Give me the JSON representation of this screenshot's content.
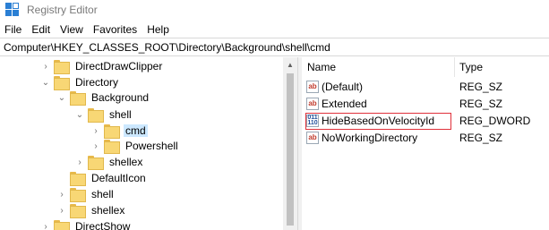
{
  "window": {
    "title": "Registry Editor",
    "accent_color": "#2a7fd4",
    "folder_color": "#f8d775"
  },
  "menu": [
    "File",
    "Edit",
    "View",
    "Favorites",
    "Help"
  ],
  "address": {
    "path": "Computer\\HKEY_CLASSES_ROOT\\Directory\\Background\\shell\\cmd"
  },
  "tree": [
    {
      "label": "DirectDrawClipper",
      "expander": "right"
    },
    {
      "label": "Directory",
      "expander": "down"
    },
    {
      "label": "Background",
      "expander": "down"
    },
    {
      "label": "shell",
      "expander": "down"
    },
    {
      "label": "cmd",
      "expander": "right",
      "selected": true
    },
    {
      "label": "Powershell",
      "expander": "right"
    },
    {
      "label": "shellex",
      "expander": "right"
    },
    {
      "label": "DefaultIcon",
      "expander": "none"
    },
    {
      "label": "shell",
      "expander": "right"
    },
    {
      "label": "shellex",
      "expander": "right"
    },
    {
      "label": "DirectShow",
      "expander": "right"
    }
  ],
  "list": {
    "columns": {
      "name": "Name",
      "type": "Type"
    },
    "rows": [
      {
        "icon": "string-value-icon",
        "icon_text": "ab",
        "name": "(Default)",
        "type": "REG_SZ"
      },
      {
        "icon": "string-value-icon",
        "icon_text": "ab",
        "name": "Extended",
        "type": "REG_SZ"
      },
      {
        "icon": "binary-value-icon",
        "icon_text": "011\n110",
        "name": "HideBasedOnVelocityId",
        "type": "REG_DWORD",
        "highlighted": true
      },
      {
        "icon": "string-value-icon",
        "icon_text": "ab",
        "name": "NoWorkingDirectory",
        "type": "REG_SZ"
      }
    ]
  }
}
